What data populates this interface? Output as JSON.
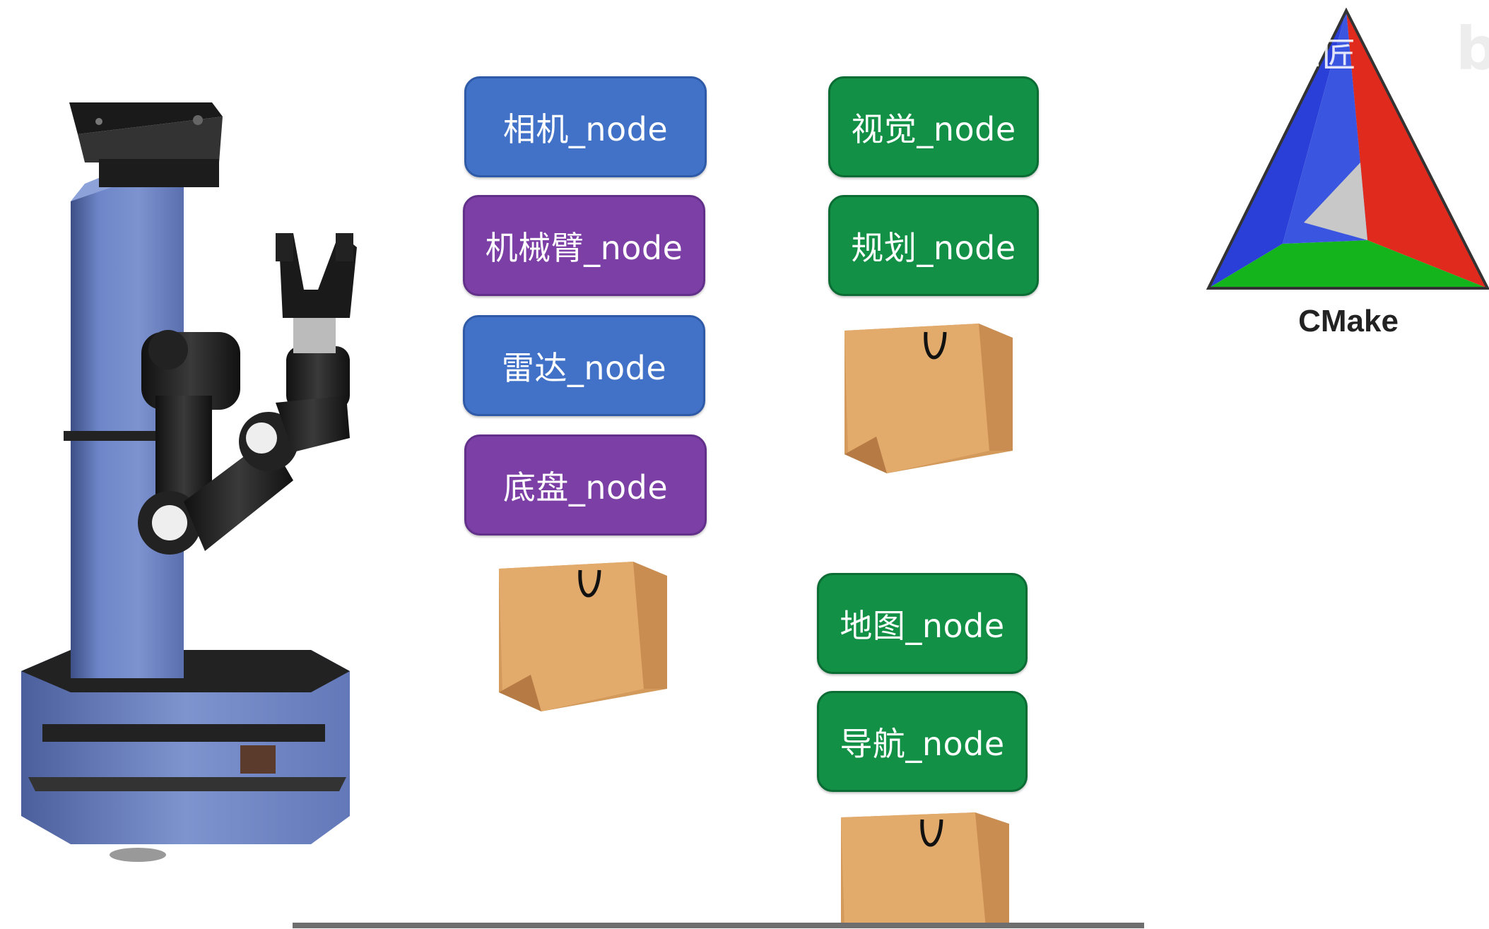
{
  "nodes_left": [
    {
      "label": "相机_node",
      "color": "#4272c8"
    },
    {
      "label": "机械臂_node",
      "color": "#7b3fa5"
    },
    {
      "label": "雷达_node",
      "color": "#4272c8"
    },
    {
      "label": "底盘_node",
      "color": "#7b3fa5"
    }
  ],
  "nodes_right_top": [
    {
      "label": "视觉_node",
      "color": "#119046"
    },
    {
      "label": "规划_node",
      "color": "#119046"
    }
  ],
  "nodes_right_bottom": [
    {
      "label": "地图_node",
      "color": "#119046"
    },
    {
      "label": "导航_node",
      "color": "#119046"
    }
  ],
  "logo": {
    "name": "CMake",
    "colors": {
      "blue": "#2a3fd8",
      "red": "#e02a1e",
      "green": "#14b41c",
      "gray": "#c8c8c8"
    }
  },
  "watermark": "1匠",
  "icons": [
    "robot-illustration",
    "shopping-bag-icon",
    "cmake-logo-icon",
    "bilibili-logo-icon"
  ]
}
